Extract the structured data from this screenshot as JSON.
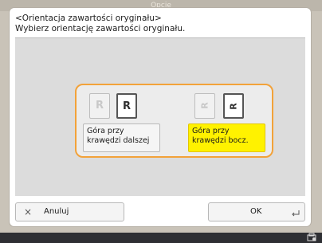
{
  "background": {
    "title": "Opcje"
  },
  "dialog": {
    "header": {
      "line1": "<Orientacja zawartości oryginału>",
      "line2": "Wybierz orientację zawartości oryginału."
    },
    "options": [
      {
        "label_line1": "Góra przy",
        "label_line2": "krawędzi dalszej",
        "icon_glyph": "R",
        "selected": false
      },
      {
        "label_line1": "Góra przy",
        "label_line2": "krawędzi bocz.",
        "icon_glyph": "R",
        "selected": true
      }
    ],
    "buttons": {
      "cancel_label": "Anuluj",
      "cancel_glyph": "×",
      "ok_label": "OK"
    }
  },
  "colors": {
    "selection_border": "#f2a23a",
    "selected_fill": "#fff200"
  }
}
